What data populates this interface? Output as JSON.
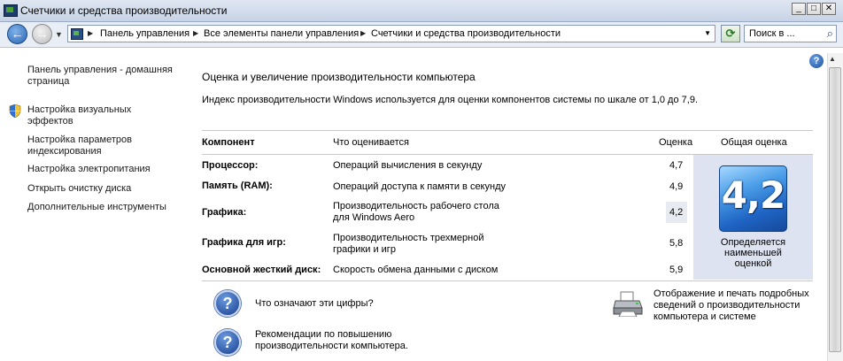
{
  "window": {
    "title": "Счетчики и средства производительности"
  },
  "address": {
    "crumbs": [
      "Панель управления",
      "Все элементы панели управления",
      "Счетчики и средства производительности"
    ],
    "search_placeholder": "Поиск в ..."
  },
  "sidebar": {
    "items": [
      {
        "label": "Панель управления - домашняя страница",
        "line1": "Панель управления - домашняя",
        "line2": "страница"
      },
      {
        "label": "Настройка визуальных эффектов",
        "line1": "Настройка визуальных",
        "line2": "эффектов",
        "icon": "shield-icon"
      },
      {
        "label": "Настройка параметров индексирования",
        "line1": "Настройка параметров",
        "line2": "индексирования"
      },
      {
        "label": "Настройка электропитания"
      },
      {
        "label": "Открыть очистку диска"
      },
      {
        "label": "Дополнительные инструменты"
      }
    ]
  },
  "main": {
    "heading": "Оценка и увеличение производительности компьютера",
    "description": "Индекс производительности Windows используется для оценки компонентов системы по шкале от 1,0 до 7,9.",
    "table": {
      "headers": {
        "component": "Компонент",
        "rated": "Что оценивается",
        "subscore": "Оценка",
        "base": "Общая оценка"
      },
      "rows": [
        {
          "component": "Процессор:",
          "rated_1": "Операций вычисления в секунду",
          "rated_2": "",
          "subscore": "4,7"
        },
        {
          "component": "Память (RAM):",
          "rated_1": "Операций доступа к памяти в секунду",
          "rated_2": "",
          "subscore": "4,9"
        },
        {
          "component": "Графика:",
          "rated_1": "Производительность рабочего стола",
          "rated_2": "для Windows Aero",
          "subscore": "4,2"
        },
        {
          "component": "Графика для игр:",
          "rated_1": "Производительность трехмерной",
          "rated_2": "графики и игр",
          "subscore": "5,8"
        },
        {
          "component": "Основной жесткий диск:",
          "rated_1": "Скорость обмена данными с диском",
          "rated_2": "",
          "subscore": "5,9"
        }
      ],
      "base_score": "4,2",
      "base_caption": [
        "Определяется",
        "наименьшей",
        "оценкой"
      ]
    },
    "links": {
      "what_numbers": "Что означают эти цифры?",
      "tips_1": "Рекомендации по повышению",
      "tips_2": "производительности компьютера.",
      "print_1": "Отображение и печать подробных",
      "print_2": "сведений о производительности",
      "print_3": "компьютера и системе"
    }
  },
  "colors": {
    "accent": "#1f64c4",
    "base_panel": "#dde3f0",
    "titlebar": "#c7d3e6"
  }
}
